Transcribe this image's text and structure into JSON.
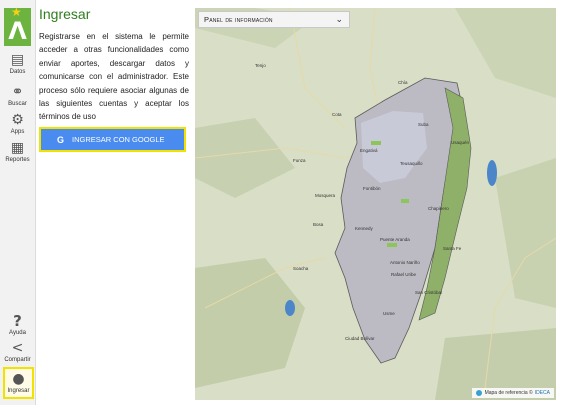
{
  "sidebar": {
    "items": [
      {
        "name": "datos",
        "label": "Datos",
        "icon": "layers-icon"
      },
      {
        "name": "buscar",
        "label": "Buscar",
        "icon": "binoculars-icon"
      },
      {
        "name": "apps",
        "label": "Apps",
        "icon": "gear-icon"
      },
      {
        "name": "reportes",
        "label": "Reportes",
        "icon": "report-icon"
      },
      {
        "name": "ayuda",
        "label": "Ayuda",
        "icon": "help-icon"
      },
      {
        "name": "compartir",
        "label": "Compartir",
        "icon": "share-icon"
      },
      {
        "name": "ingresar",
        "label": "Ingresar",
        "icon": "user-icon",
        "active": true
      }
    ]
  },
  "login": {
    "title": "Ingresar",
    "description": "Registrarse en el sistema le permite acceder a otras funcionalidades como enviar aportes, descargar datos y comunicarse con el administrador. Este proceso sólo requiere asociar algunas de las siguientes cuentas y aceptar los términos de uso",
    "google_button": "INGRESAR CON GOOGLE",
    "google_icon": "G"
  },
  "map": {
    "info_panel_label": "Panel de información",
    "labels": [
      "Tenjo",
      "Cota",
      "Chía",
      "Usaquén",
      "Suba",
      "Engativá",
      "Fontibón",
      "Teusaquillo",
      "Chapinero",
      "Santa Fe",
      "Kennedy",
      "Bosa",
      "Puente Aranda",
      "Antonio Nariño",
      "Rafael Uribe",
      "San Cristóbal",
      "Usme",
      "Ciudad Bolívar",
      "Mosquera",
      "Funza",
      "Soacha"
    ],
    "attribution_text": "Mapa de referencia ©",
    "attribution_link": "IDECA"
  },
  "colors": {
    "brand_green": "#6db33f",
    "title_green": "#2f7d1f",
    "google_blue": "#4a8bf0",
    "highlight_yellow": "#f2e200"
  }
}
